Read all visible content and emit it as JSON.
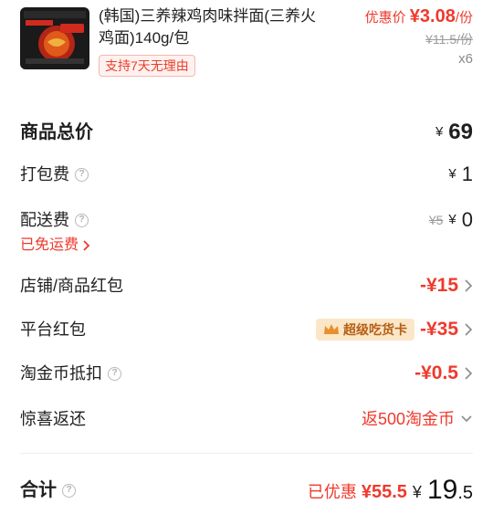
{
  "product": {
    "title": "(韩国)三养辣鸡肉味拌面(三养火鸡面)140g/包",
    "tag": "支持7天无理由",
    "discount_label": "优惠价",
    "discount_price": "¥3.08",
    "per_unit": "/份",
    "original_price": "¥11.5/份",
    "quantity": "x6"
  },
  "summary": {
    "goods_total": {
      "label": "商品总价",
      "currency": "¥",
      "value": "69"
    },
    "packing_fee": {
      "label": "打包费",
      "currency": "¥",
      "value": "1"
    },
    "delivery_fee": {
      "label": "配送费",
      "original": "¥5",
      "currency": "¥",
      "value": "0",
      "note": "已免运费"
    },
    "shop_coupon": {
      "label": "店铺/商品红包",
      "value": "-¥15"
    },
    "platform_coupon": {
      "label": "平台红包",
      "badge": "超级吃货卡",
      "value": "-¥35"
    },
    "taojin_coin": {
      "label": "淘金币抵扣",
      "value": "-¥0.5"
    },
    "surprise_cashback": {
      "label": "惊喜返还",
      "value": "返500淘金币"
    },
    "total": {
      "label": "合计",
      "saved_label": "已优惠",
      "saved_amount": "¥55.5",
      "currency": "¥",
      "integer": "19",
      "decimal": ".5"
    }
  },
  "colors": {
    "accent_red": "#ef3a2c",
    "badge_bg": "#fbe7c8",
    "badge_text": "#b55f14"
  },
  "icons": [
    "product-thumbnail",
    "help-circle-icon",
    "chevron-right-icon",
    "chevron-down-icon",
    "crown-icon"
  ]
}
